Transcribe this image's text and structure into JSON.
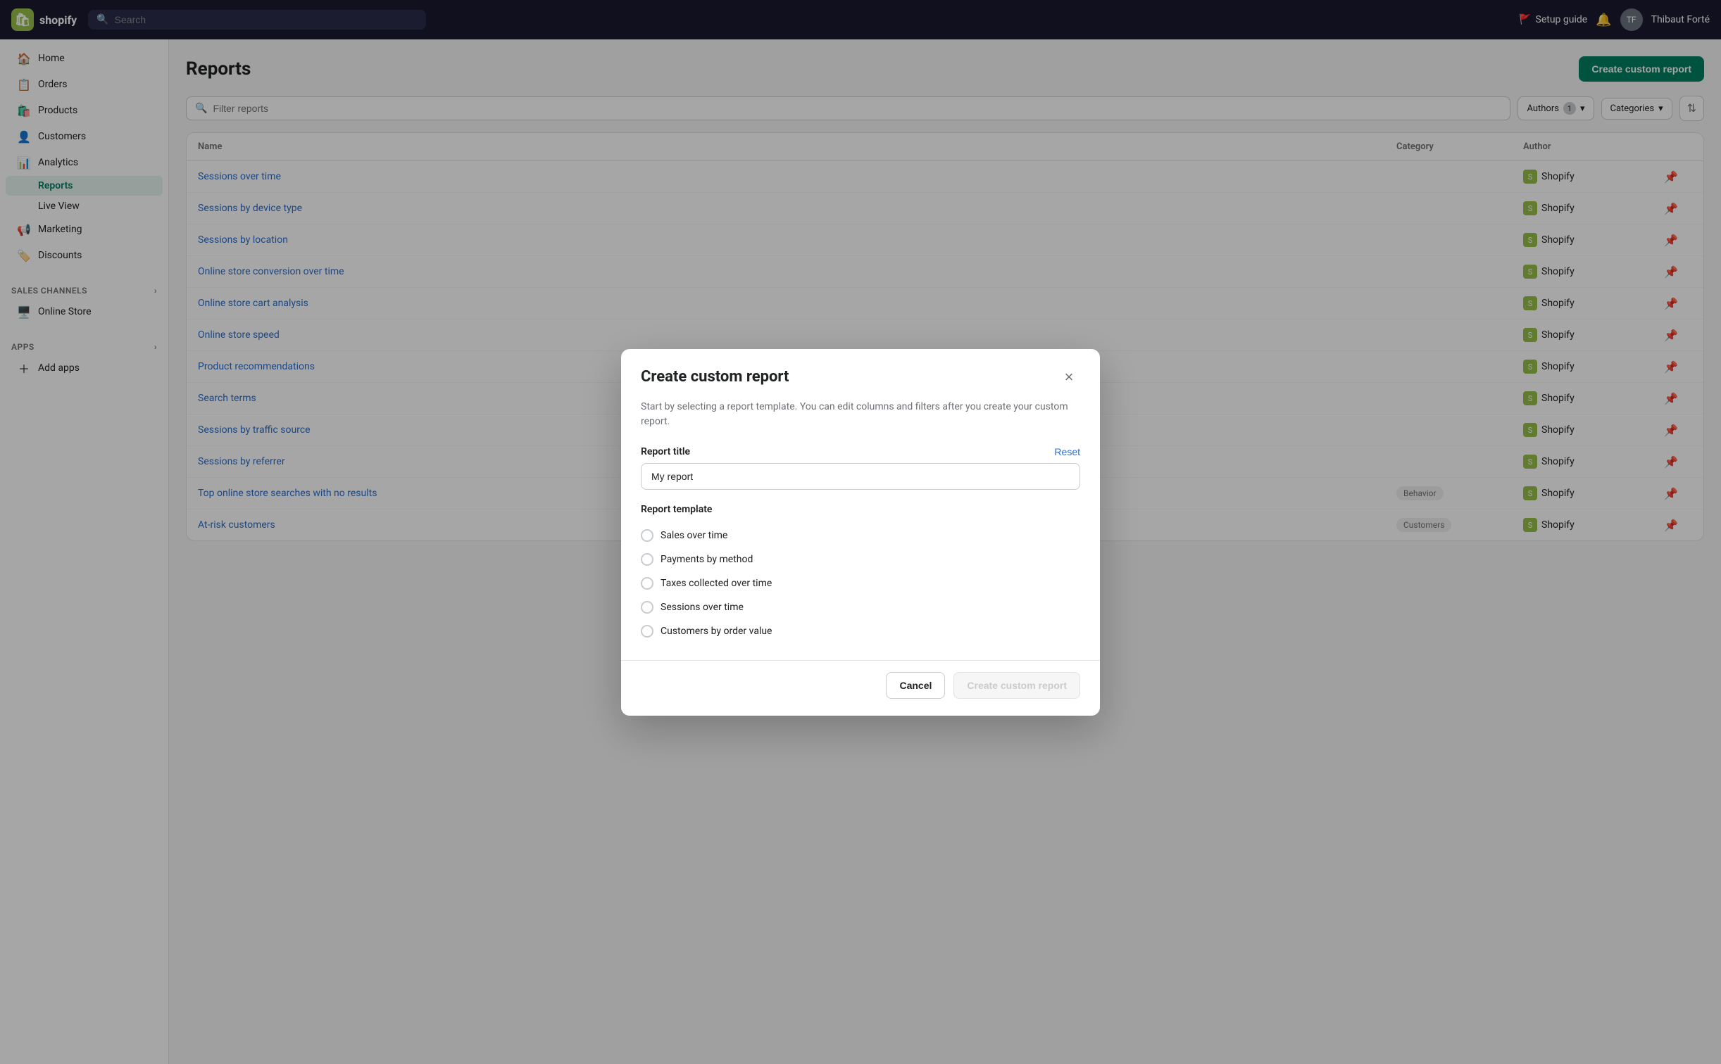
{
  "topbar": {
    "logo_text": "shopify",
    "search_placeholder": "Search",
    "setup_guide_label": "Setup guide",
    "user_name": "Thibaut Forté"
  },
  "sidebar": {
    "nav_items": [
      {
        "id": "home",
        "label": "Home",
        "icon": "🏠"
      },
      {
        "id": "orders",
        "label": "Orders",
        "icon": "📋"
      },
      {
        "id": "products",
        "label": "Products",
        "icon": "🛍️"
      },
      {
        "id": "customers",
        "label": "Customers",
        "icon": "👤"
      },
      {
        "id": "analytics",
        "label": "Analytics",
        "icon": "📊"
      },
      {
        "id": "marketing",
        "label": "Marketing",
        "icon": "📢"
      },
      {
        "id": "discounts",
        "label": "Discounts",
        "icon": "🏷️"
      }
    ],
    "analytics_sub": [
      {
        "id": "reports",
        "label": "Reports",
        "active": true
      },
      {
        "id": "live-view",
        "label": "Live View",
        "active": false
      }
    ],
    "sales_channels_label": "Sales channels",
    "online_store_label": "Online Store",
    "apps_label": "Apps",
    "add_apps_label": "Add apps"
  },
  "page": {
    "title": "Reports",
    "create_button": "Create custom report"
  },
  "filter_bar": {
    "search_placeholder": "Filter reports",
    "authors_chip": "Authors",
    "authors_count": "1",
    "categories_chip": "Categories"
  },
  "table": {
    "columns": [
      "Name",
      "Category",
      "Author",
      ""
    ],
    "rows": [
      {
        "name": "Sessions...",
        "category": "",
        "author": "Shopify"
      },
      {
        "name": "Sessions...",
        "category": "",
        "author": "Shopify"
      },
      {
        "name": "Sessions...",
        "category": "",
        "author": "Shopify"
      },
      {
        "name": "Onl...",
        "category": "",
        "author": "Shopify"
      },
      {
        "name": "Onl...",
        "category": "",
        "author": "Shopify"
      },
      {
        "name": "Onl...",
        "category": "",
        "author": "Shopify"
      },
      {
        "name": "Pro...",
        "category": "",
        "author": "Shopify"
      },
      {
        "name": "Sea...",
        "category": "",
        "author": "Shopify"
      },
      {
        "name": "Ses...",
        "category": "",
        "author": "Shopify"
      },
      {
        "name": "Ses...",
        "category": "",
        "author": "Shopify"
      },
      {
        "name": "Top online store searches with no results",
        "category": "Behavior",
        "author": "Shopify"
      },
      {
        "name": "At-risk customers",
        "category": "Customers",
        "author": "Shopify"
      }
    ]
  },
  "modal": {
    "title": "Create custom report",
    "close_icon": "×",
    "description": "Start by selecting a report template. You can edit columns and filters after you create your custom report.",
    "report_title_label": "Report title",
    "reset_label": "Reset",
    "report_title_value": "My report",
    "report_template_label": "Report template",
    "templates": [
      {
        "id": "sales-over-time",
        "label": "Sales over time"
      },
      {
        "id": "payments-by-method",
        "label": "Payments by method"
      },
      {
        "id": "taxes-collected-over-time",
        "label": "Taxes collected over time"
      },
      {
        "id": "sessions-over-time",
        "label": "Sessions over time"
      },
      {
        "id": "customers-by-order-value",
        "label": "Customers by order value"
      }
    ],
    "cancel_label": "Cancel",
    "create_label": "Create custom report"
  }
}
